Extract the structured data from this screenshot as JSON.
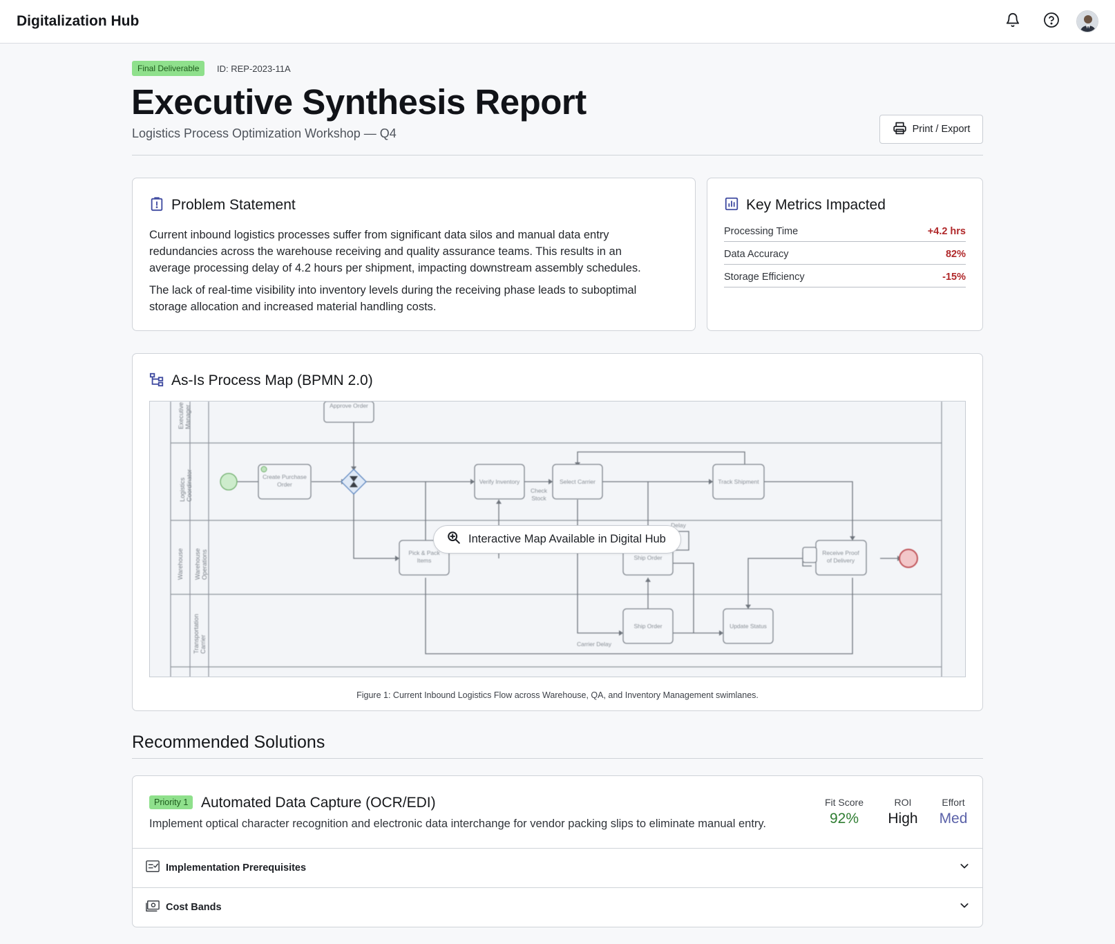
{
  "app": {
    "title": "Digitalization Hub"
  },
  "header_icons": [
    "bell-icon",
    "help-icon",
    "avatar"
  ],
  "report": {
    "badge": "Final Deliverable",
    "id": "ID: REP-2023-11A",
    "title": "Executive Synthesis Report",
    "subtitle": "Logistics Process Optimization Workshop — Q4",
    "print_label": "Print / Export"
  },
  "problem": {
    "title": "Problem Statement",
    "paragraphs": [
      "Current inbound logistics processes suffer from significant data silos and manual data entry redundancies across the warehouse receiving and quality assurance teams. This results in an average processing delay of 4.2 hours per shipment, impacting downstream assembly schedules.",
      "The lack of real-time visibility into inventory levels during the receiving phase leads to suboptimal storage allocation and increased material handling costs."
    ]
  },
  "metrics": {
    "title": "Key Metrics Impacted",
    "items": [
      {
        "label": "Processing Time",
        "value": "+4.2 hrs"
      },
      {
        "label": "Data Accuracy",
        "value": "82%"
      },
      {
        "label": "Storage Efficiency",
        "value": "-15%"
      }
    ]
  },
  "process_map": {
    "title": "As-Is Process Map (BPMN 2.0)",
    "overlay_label": "Interactive Map Available in Digital Hub",
    "caption": "Figure 1: Current Inbound Logistics Flow across Warehouse, QA, and Inventory Management swimlanes.",
    "diagram_labels": {
      "approve_order": "Approve Order",
      "create_po": [
        "Create Purchase",
        "Order"
      ],
      "verify_inventory": "Verify Inventory",
      "select_carrier": "Select Carrier",
      "track_shipment": "Track Shipment",
      "check_stock": [
        "Check",
        "Stock"
      ],
      "pick_pack": [
        "Pick & Pack",
        "Items"
      ],
      "ship_order_1": "Ship Order",
      "ship_order_2": "Ship Order",
      "receive_proof": [
        "Receive Proof",
        "of Delivery"
      ],
      "update_status": "Update Status",
      "carrier_delay": "Carrier Delay",
      "delay": "Delay",
      "lane_exec": [
        "Executive",
        "Manager"
      ],
      "lane_log": [
        "Logistics",
        "Coordinator"
      ],
      "lane_wh_group": "Warehouse",
      "lane_wh": [
        "Warehouse",
        "Operations"
      ],
      "lane_tr": [
        "Transportation",
        "Carrier"
      ]
    }
  },
  "solutions": {
    "section_title": "Recommended Solutions",
    "items": [
      {
        "priority": "Priority 1",
        "title": "Automated Data Capture (OCR/EDI)",
        "description": "Implement optical character recognition and electronic data interchange for vendor packing slips to eliminate manual entry.",
        "stats": [
          {
            "label": "Fit Score",
            "value": "92%",
            "color": "#2f7d32"
          },
          {
            "label": "ROI",
            "value": "High",
            "color": "#15171a"
          },
          {
            "label": "Effort",
            "value": "Med",
            "color": "#5a61a8"
          }
        ],
        "accordions": [
          {
            "label": "Implementation Prerequisites",
            "icon": "checklist-icon"
          },
          {
            "label": "Cost Bands",
            "icon": "cash-icon"
          }
        ]
      }
    ]
  },
  "colors": {
    "accent_indigo": "#3f4aa0",
    "negative": "#b0282a",
    "badge_green": "#8fe08c"
  }
}
